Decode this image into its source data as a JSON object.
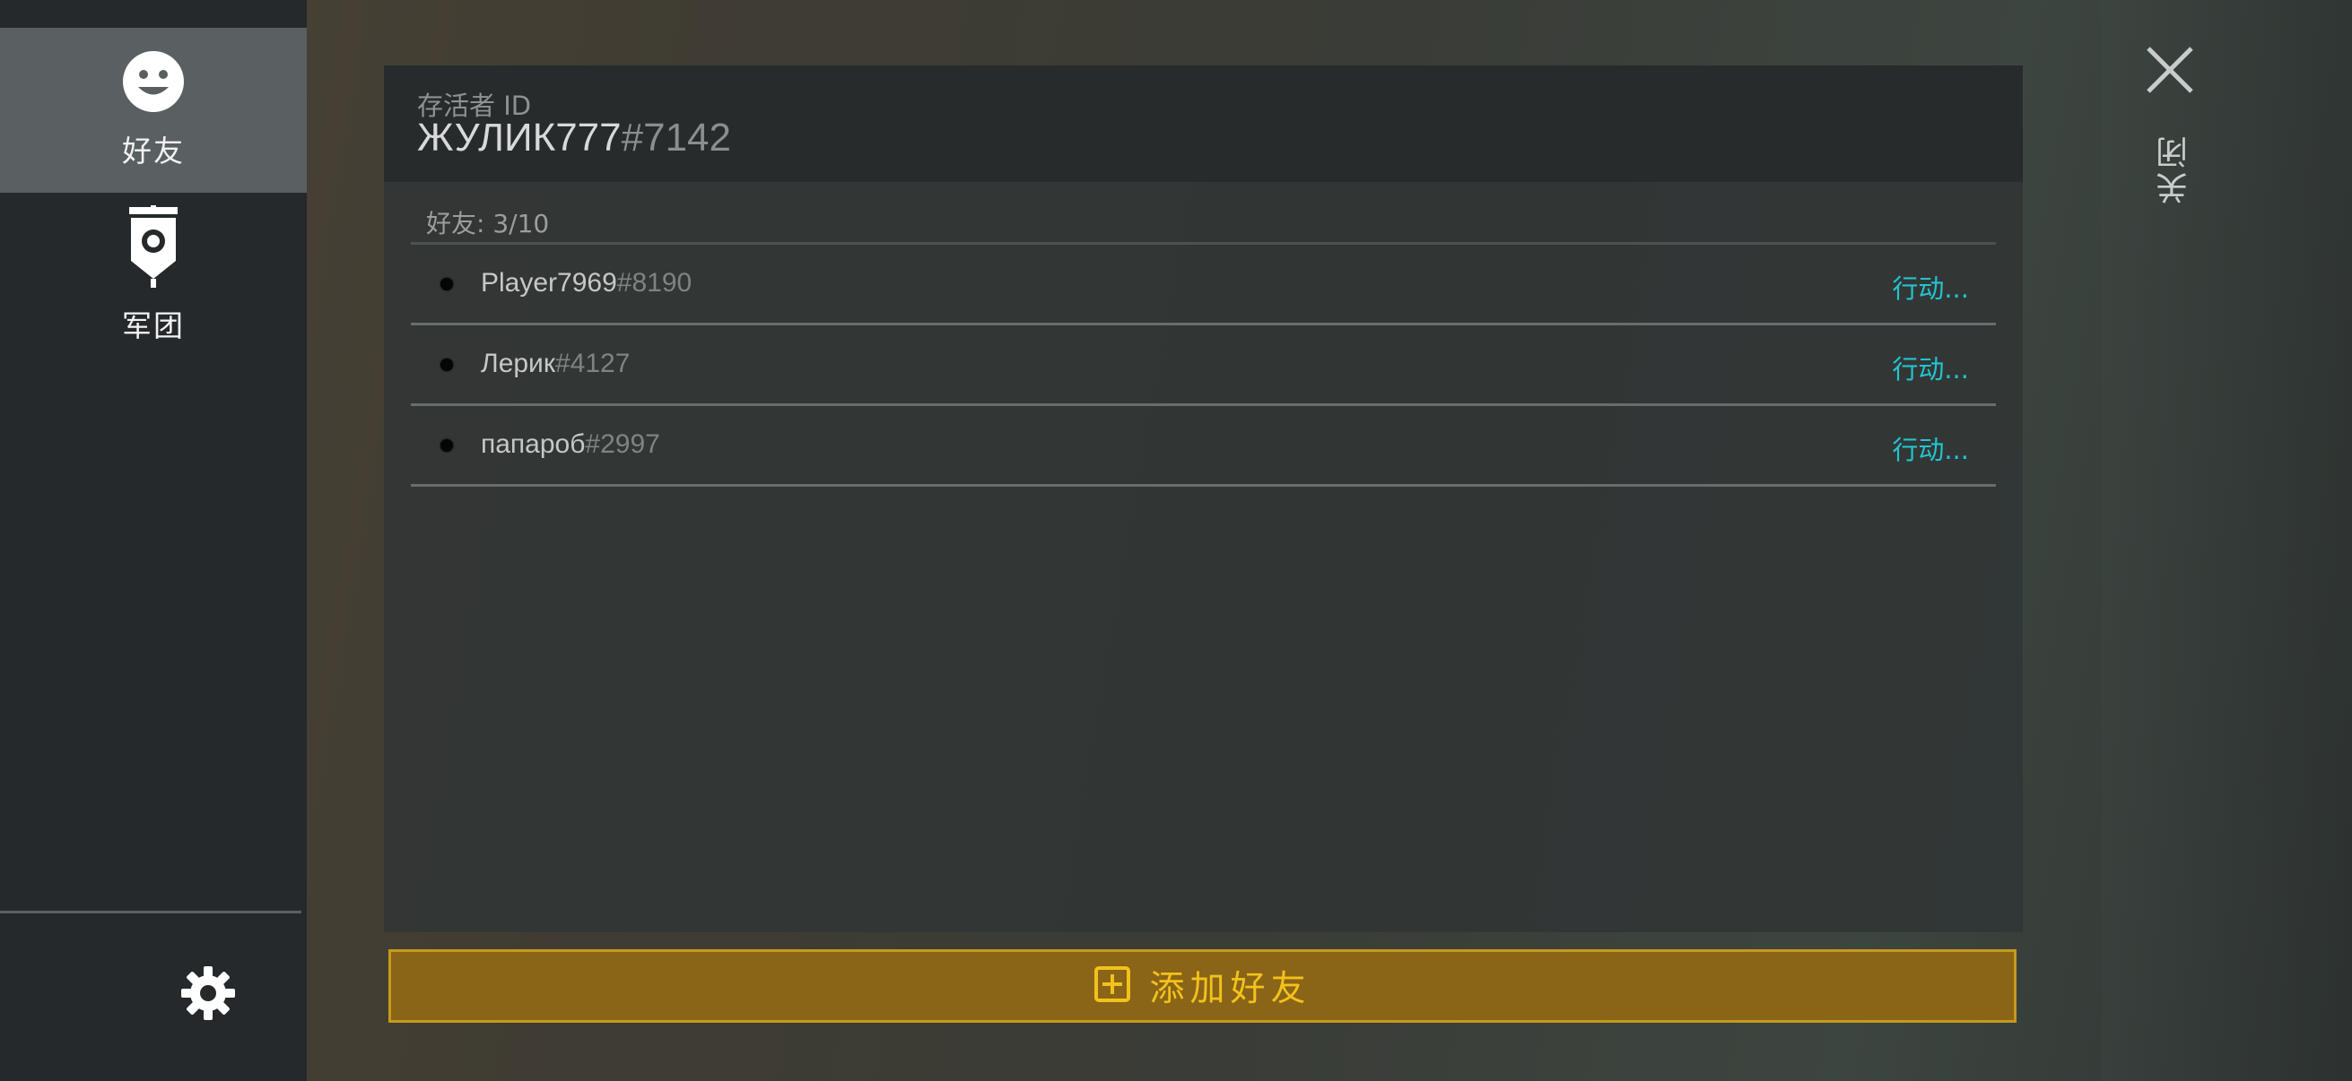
{
  "sidebar": {
    "items": [
      {
        "label": "好友",
        "icon": "smiley-icon",
        "active": true
      },
      {
        "label": "军团",
        "icon": "clan-banner-icon",
        "active": false
      }
    ],
    "settings_icon": "gear-icon"
  },
  "header": {
    "id_caption": "存活者 ID",
    "player_name": "ЖУЛИК777",
    "player_tag": "#7142"
  },
  "friends": {
    "count_label": "好友: 3/10",
    "list": [
      {
        "name": "Player7969",
        "tag": "#8190",
        "action": "行动..."
      },
      {
        "name": "Лерик",
        "tag": "#4127",
        "action": "行动..."
      },
      {
        "name": "папароб",
        "tag": "#2997",
        "action": "行动..."
      }
    ]
  },
  "add_button": {
    "label": "添加好友",
    "icon": "plus-square-icon"
  },
  "close": {
    "label": "关闭",
    "icon": "close-icon"
  },
  "colors": {
    "accent_cyan": "#23c4cf",
    "button_fill": "#8a6417",
    "button_text": "#f2c21b"
  }
}
